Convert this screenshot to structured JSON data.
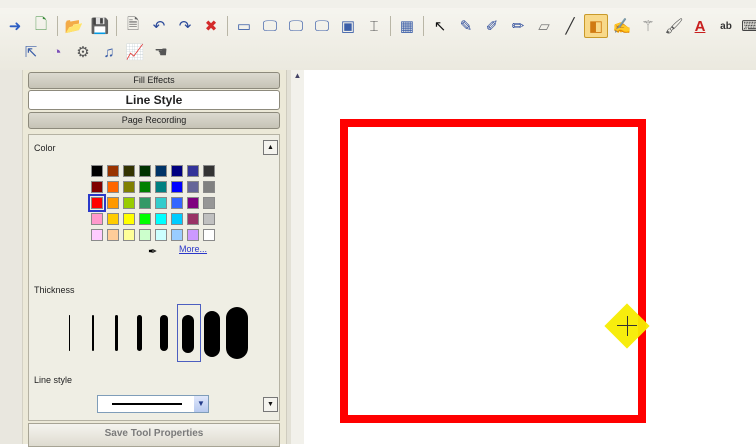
{
  "toolbar": {
    "row1": [
      {
        "name": "arrow-right-icon",
        "glyph": "➜",
        "color": "#2d5fc4"
      },
      {
        "name": "new-page-icon",
        "glyph": "🗋",
        "color": "#3c8c3c"
      },
      {
        "sep": true
      },
      {
        "name": "open-folder-icon",
        "glyph": "📂",
        "color": "#c8941e"
      },
      {
        "name": "save-icon",
        "glyph": "💾",
        "color": "#2b4a9a"
      },
      {
        "sep": true
      },
      {
        "name": "print-preview-icon",
        "glyph": "🗎",
        "color": "#666666"
      },
      {
        "name": "undo-icon",
        "glyph": "↶",
        "color": "#2b4a9a"
      },
      {
        "name": "redo-icon",
        "glyph": "↷",
        "color": "#2b4a9a"
      },
      {
        "name": "delete-icon",
        "glyph": "✖",
        "color": "#d42a2a"
      },
      {
        "sep": true
      },
      {
        "name": "screen-shade-icon",
        "glyph": "▭",
        "color": "#3b5ea8"
      },
      {
        "name": "monitor-icon",
        "glyph": "🖵",
        "color": "#3b5ea8"
      },
      {
        "name": "monitor-outline-icon",
        "glyph": "🖵",
        "color": "#3b5ea8"
      },
      {
        "name": "spotlight-monitor-icon",
        "glyph": "🖵",
        "color": "#3b5ea8"
      },
      {
        "name": "capture-icon",
        "glyph": "▣",
        "color": "#3b5ea8"
      },
      {
        "name": "ruler-icon",
        "glyph": "⌶",
        "color": "#555555"
      },
      {
        "sep": true
      },
      {
        "name": "table-icon",
        "glyph": "▦",
        "color": "#3b5ea8"
      },
      {
        "sep": true
      },
      {
        "name": "select-arrow-icon",
        "glyph": "↖",
        "color": "#111111"
      },
      {
        "name": "pen-icon",
        "glyph": "✎",
        "color": "#2b4a9a"
      },
      {
        "name": "creative-pen-icon",
        "glyph": "✐",
        "color": "#2b4a9a"
      },
      {
        "name": "highlighter-icon",
        "glyph": "✏",
        "color": "#2b4a9a"
      },
      {
        "name": "eraser-icon",
        "glyph": "▱",
        "color": "#777777"
      },
      {
        "name": "line-icon",
        "glyph": "╱",
        "color": "#333333"
      },
      {
        "name": "shape-tool-icon",
        "glyph": "◧",
        "color": "#d07a12",
        "active": true
      },
      {
        "name": "shape-pen-icon",
        "glyph": "✍",
        "color": "#444444"
      },
      {
        "name": "magic-wand-icon",
        "glyph": "⚚",
        "color": "#777777"
      },
      {
        "name": "fill-icon",
        "glyph": "🖌",
        "color": "#555555"
      },
      {
        "name": "text-icon",
        "glyph": "A",
        "color": "#c81e1e"
      },
      {
        "name": "text-recognition-icon",
        "glyph": "ab",
        "color": "#333333"
      },
      {
        "name": "keyboard-icon",
        "glyph": "⌨",
        "color": "#444444"
      }
    ],
    "row2": [
      {
        "name": "pointer-tool-icon",
        "glyph": "⇱",
        "color": "#3b5ea8"
      },
      {
        "name": "eraser-tool-icon",
        "glyph": "◔",
        "color": "#7b4fb8"
      },
      {
        "name": "recognition-icon",
        "glyph": "⚙",
        "color": "#555555"
      },
      {
        "name": "sound-icon",
        "glyph": "♫",
        "color": "#3b5ea8"
      },
      {
        "name": "chart-icon",
        "glyph": "📈",
        "color": "#3b5ea8"
      },
      {
        "name": "hand-icon",
        "glyph": "☚",
        "color": "#555555"
      }
    ]
  },
  "tabs": {
    "fill_effects": "Fill Effects",
    "line_style": "Line Style",
    "page_recording": "Page Recording"
  },
  "properties": {
    "color_label": "Color",
    "colors": [
      "#000000",
      "#993300",
      "#333300",
      "#003300",
      "#003366",
      "#000080",
      "#333399",
      "#333333",
      "#800000",
      "#ff6600",
      "#808000",
      "#008000",
      "#008080",
      "#0000ff",
      "#666699",
      "#808080",
      "#ff0000",
      "#ff9900",
      "#99cc00",
      "#339966",
      "#33cccc",
      "#3366ff",
      "#800080",
      "#969696",
      "#ff99cc",
      "#ffcc00",
      "#ffff00",
      "#00ff00",
      "#00ffff",
      "#00ccff",
      "#993366",
      "#c0c0c0",
      "#ffccff",
      "#ffcc99",
      "#ffff99",
      "#ccffcc",
      "#ccffff",
      "#99ccff",
      "#cc99ff",
      "#ffffff"
    ],
    "selected_color_index": 16,
    "more_label": "More...",
    "thickness_label": "Thickness",
    "line_style_label": "Line style",
    "save_label": "Save Tool Properties"
  },
  "canvas": {
    "stroke_color": "#ff0000",
    "cursor_color": "#f7ec00"
  }
}
